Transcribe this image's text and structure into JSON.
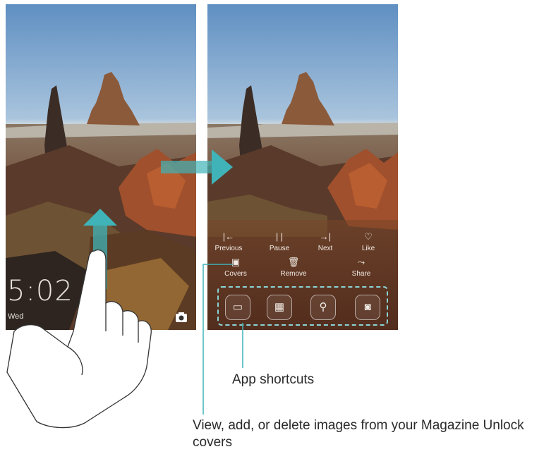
{
  "lock_left": {
    "time": "5:02",
    "date": "Wed"
  },
  "magazine": {
    "controls": [
      {
        "icon": "|←",
        "label": "Previous"
      },
      {
        "icon": "| |",
        "label": "Pause"
      },
      {
        "icon": "→|",
        "label": "Next"
      },
      {
        "icon": "♡",
        "label": "Like"
      }
    ],
    "actions": [
      {
        "icon": "▣",
        "label": "Covers"
      },
      {
        "icon": "🗑",
        "label": "Remove"
      },
      {
        "icon": "⤳",
        "label": "Share"
      }
    ],
    "shortcuts": [
      {
        "name": "remote-icon",
        "glyph": "▭"
      },
      {
        "name": "calculator-icon",
        "glyph": "▦"
      },
      {
        "name": "flashlight-icon",
        "glyph": "⚲"
      },
      {
        "name": "camera-icon",
        "glyph": "◙"
      }
    ]
  },
  "callouts": {
    "shortcuts": "App shortcuts",
    "covers": "View, add, or delete images from your Magazine Unlock covers"
  },
  "colors": {
    "accent": "#3fb3b8",
    "dock_border": "#8ad4d6"
  }
}
